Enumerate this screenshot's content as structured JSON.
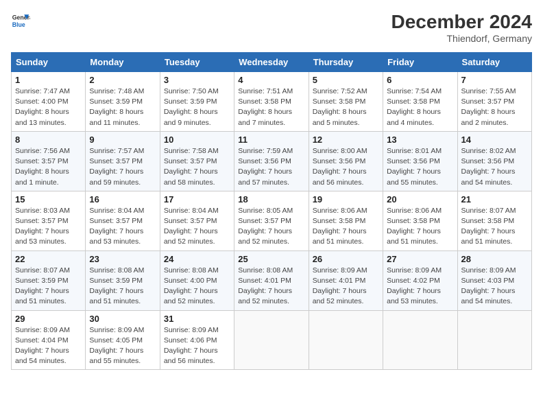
{
  "header": {
    "logo_line1": "General",
    "logo_line2": "Blue",
    "month_year": "December 2024",
    "location": "Thiendorf, Germany"
  },
  "weekdays": [
    "Sunday",
    "Monday",
    "Tuesday",
    "Wednesday",
    "Thursday",
    "Friday",
    "Saturday"
  ],
  "weeks": [
    [
      {
        "day": "1",
        "info": "Sunrise: 7:47 AM\nSunset: 4:00 PM\nDaylight: 8 hours\nand 13 minutes."
      },
      {
        "day": "2",
        "info": "Sunrise: 7:48 AM\nSunset: 3:59 PM\nDaylight: 8 hours\nand 11 minutes."
      },
      {
        "day": "3",
        "info": "Sunrise: 7:50 AM\nSunset: 3:59 PM\nDaylight: 8 hours\nand 9 minutes."
      },
      {
        "day": "4",
        "info": "Sunrise: 7:51 AM\nSunset: 3:58 PM\nDaylight: 8 hours\nand 7 minutes."
      },
      {
        "day": "5",
        "info": "Sunrise: 7:52 AM\nSunset: 3:58 PM\nDaylight: 8 hours\nand 5 minutes."
      },
      {
        "day": "6",
        "info": "Sunrise: 7:54 AM\nSunset: 3:58 PM\nDaylight: 8 hours\nand 4 minutes."
      },
      {
        "day": "7",
        "info": "Sunrise: 7:55 AM\nSunset: 3:57 PM\nDaylight: 8 hours\nand 2 minutes."
      }
    ],
    [
      {
        "day": "8",
        "info": "Sunrise: 7:56 AM\nSunset: 3:57 PM\nDaylight: 8 hours\nand 1 minute."
      },
      {
        "day": "9",
        "info": "Sunrise: 7:57 AM\nSunset: 3:57 PM\nDaylight: 7 hours\nand 59 minutes."
      },
      {
        "day": "10",
        "info": "Sunrise: 7:58 AM\nSunset: 3:57 PM\nDaylight: 7 hours\nand 58 minutes."
      },
      {
        "day": "11",
        "info": "Sunrise: 7:59 AM\nSunset: 3:56 PM\nDaylight: 7 hours\nand 57 minutes."
      },
      {
        "day": "12",
        "info": "Sunrise: 8:00 AM\nSunset: 3:56 PM\nDaylight: 7 hours\nand 56 minutes."
      },
      {
        "day": "13",
        "info": "Sunrise: 8:01 AM\nSunset: 3:56 PM\nDaylight: 7 hours\nand 55 minutes."
      },
      {
        "day": "14",
        "info": "Sunrise: 8:02 AM\nSunset: 3:56 PM\nDaylight: 7 hours\nand 54 minutes."
      }
    ],
    [
      {
        "day": "15",
        "info": "Sunrise: 8:03 AM\nSunset: 3:57 PM\nDaylight: 7 hours\nand 53 minutes."
      },
      {
        "day": "16",
        "info": "Sunrise: 8:04 AM\nSunset: 3:57 PM\nDaylight: 7 hours\nand 53 minutes."
      },
      {
        "day": "17",
        "info": "Sunrise: 8:04 AM\nSunset: 3:57 PM\nDaylight: 7 hours\nand 52 minutes."
      },
      {
        "day": "18",
        "info": "Sunrise: 8:05 AM\nSunset: 3:57 PM\nDaylight: 7 hours\nand 52 minutes."
      },
      {
        "day": "19",
        "info": "Sunrise: 8:06 AM\nSunset: 3:58 PM\nDaylight: 7 hours\nand 51 minutes."
      },
      {
        "day": "20",
        "info": "Sunrise: 8:06 AM\nSunset: 3:58 PM\nDaylight: 7 hours\nand 51 minutes."
      },
      {
        "day": "21",
        "info": "Sunrise: 8:07 AM\nSunset: 3:58 PM\nDaylight: 7 hours\nand 51 minutes."
      }
    ],
    [
      {
        "day": "22",
        "info": "Sunrise: 8:07 AM\nSunset: 3:59 PM\nDaylight: 7 hours\nand 51 minutes."
      },
      {
        "day": "23",
        "info": "Sunrise: 8:08 AM\nSunset: 3:59 PM\nDaylight: 7 hours\nand 51 minutes."
      },
      {
        "day": "24",
        "info": "Sunrise: 8:08 AM\nSunset: 4:00 PM\nDaylight: 7 hours\nand 52 minutes."
      },
      {
        "day": "25",
        "info": "Sunrise: 8:08 AM\nSunset: 4:01 PM\nDaylight: 7 hours\nand 52 minutes."
      },
      {
        "day": "26",
        "info": "Sunrise: 8:09 AM\nSunset: 4:01 PM\nDaylight: 7 hours\nand 52 minutes."
      },
      {
        "day": "27",
        "info": "Sunrise: 8:09 AM\nSunset: 4:02 PM\nDaylight: 7 hours\nand 53 minutes."
      },
      {
        "day": "28",
        "info": "Sunrise: 8:09 AM\nSunset: 4:03 PM\nDaylight: 7 hours\nand 54 minutes."
      }
    ],
    [
      {
        "day": "29",
        "info": "Sunrise: 8:09 AM\nSunset: 4:04 PM\nDaylight: 7 hours\nand 54 minutes."
      },
      {
        "day": "30",
        "info": "Sunrise: 8:09 AM\nSunset: 4:05 PM\nDaylight: 7 hours\nand 55 minutes."
      },
      {
        "day": "31",
        "info": "Sunrise: 8:09 AM\nSunset: 4:06 PM\nDaylight: 7 hours\nand 56 minutes."
      },
      null,
      null,
      null,
      null
    ]
  ]
}
